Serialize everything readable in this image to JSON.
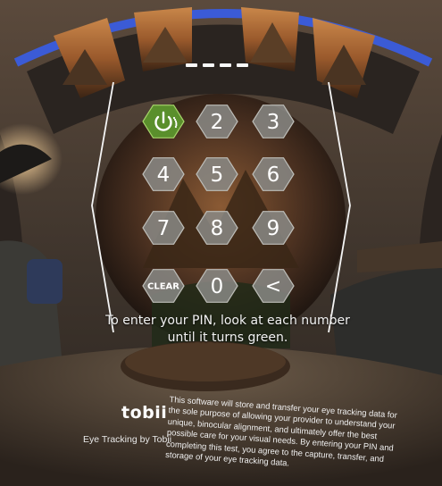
{
  "keypad": {
    "keys": [
      {
        "label": "",
        "kind": "power-icon",
        "state": "selected"
      },
      {
        "label": "2",
        "kind": "digit"
      },
      {
        "label": "3",
        "kind": "digit"
      },
      {
        "label": "4",
        "kind": "digit"
      },
      {
        "label": "5",
        "kind": "digit"
      },
      {
        "label": "6",
        "kind": "digit"
      },
      {
        "label": "7",
        "kind": "digit"
      },
      {
        "label": "8",
        "kind": "digit"
      },
      {
        "label": "9",
        "kind": "digit"
      },
      {
        "label": "CLEAR",
        "kind": "clear"
      },
      {
        "label": "0",
        "kind": "digit"
      },
      {
        "label": "<",
        "kind": "backspace"
      }
    ]
  },
  "pin": {
    "length": 4,
    "entered": 0
  },
  "instruction": {
    "line1": "To enter your PIN, look at each number",
    "line2": "until it turns green."
  },
  "brand": {
    "logo": "tobii",
    "caption": "Eye Tracking by Tobii"
  },
  "disclaimer": {
    "text": "This software will store and transfer your eye tracking data for the sole purpose of allowing your provider to understand your unique, binocular alignment, and ultimately offer the best possible care for your visual needs. By entering your PIN and completing this test, you agree to the capture, transfer, and storage of your eye tracking data."
  },
  "colors": {
    "selected_key": "#5a8f2c",
    "key_fill": "#8a8a86",
    "text": "#ffffff"
  }
}
